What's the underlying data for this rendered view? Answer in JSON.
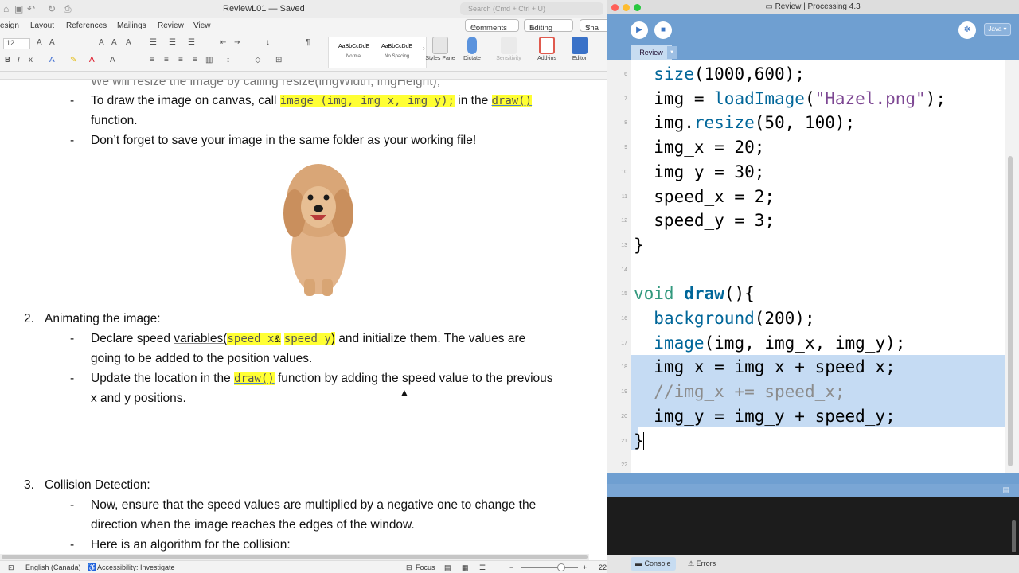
{
  "word": {
    "doc_title": "ReviewL01 — Saved",
    "search_placeholder": "Search (Cmd + Ctrl + U)",
    "tabs": [
      "esign",
      "Layout",
      "References",
      "Mailings",
      "Review",
      "View"
    ],
    "comments_label": "Comments",
    "editing_label": "Editing",
    "share_label": "Sha",
    "font_size": "12",
    "style_normal_preview": "AaBbCcDdE",
    "style_normal": "Normal",
    "style_nospacing_preview": "AaBbCcDdE",
    "style_nospacing": "No Spacing",
    "styles_pane": "Styles Pane",
    "dictate": "Dictate",
    "sensitivity": "Sensitivity",
    "addins": "Add-ins",
    "editor": "Editor",
    "doc": {
      "cut_line": "We will resize the image by calling resize(imgWidth, imgHeight);",
      "b1_pre": "To draw the image on canvas, call",
      "b1_code": "image (img, img_x, img_y);",
      "b1_mid": "in the",
      "b1_draw": "draw()",
      "b1_cont": "function.",
      "b2": "Don’t forget to save your image in the same folder as your working file!",
      "s2_num": "2.",
      "s2_title": "Animating the image:",
      "b3_pre": "Declare speed",
      "b3_var": "variables(",
      "b3_sx": "speed_x",
      "b3_amp": "&",
      "b3_sy": "speed_y",
      "b3_paren": ")",
      "b3_post": " and initialize them. The values are",
      "b3_cont": "going to be added to the position values.",
      "b4_pre": "Update the location in the",
      "b4_draw": "draw()",
      "b4_post": " function by adding the speed value to the previous",
      "b4_cont": "x and y positions.",
      "s3_num": "3.",
      "s3_title": "Collision Detection:",
      "b5": "Now, ensure that the speed values are multiplied by a negative one to change the",
      "b5_cont": "direction when the image reaches the edges of the window.",
      "b6": "Here is an algorithm for the collision:"
    },
    "status": {
      "language": "English (Canada)",
      "accessibility": "Accessibility: Investigate",
      "focus": "Focus",
      "zoom": "22"
    }
  },
  "processing": {
    "window_title": "Review | Processing 4.3",
    "mode": "Java",
    "tab": "Review",
    "line_numbers": [
      "6",
      "7",
      "8",
      "9",
      "10",
      "11",
      "12",
      "13",
      "14",
      "15",
      "16",
      "17",
      "18",
      "19",
      "20",
      "21",
      "22"
    ],
    "code": [
      "  size(1000,600);",
      "  img = loadImage(\"Hazel.png\");",
      "  img.resize(50, 100);",
      "  img_x = 20;",
      "  img_y = 30;",
      "  speed_x = 2;",
      "  speed_y = 3;",
      "}",
      "",
      "void draw(){",
      "  background(200);",
      "  image(img, img_x, img_y);",
      "  img_x = img_x + speed_x;",
      "  //img_x += speed_x;",
      "  img_y = img_y + speed_y;",
      "}"
    ],
    "console_tab": "Console",
    "errors_tab": "Errors",
    "colors": {
      "keyword": "#33997e",
      "function": "#006699",
      "string": "#7d4793",
      "comment": "#8c8c8c",
      "selection": "#c5dbf3",
      "chrome": "#6f9fd1"
    }
  }
}
